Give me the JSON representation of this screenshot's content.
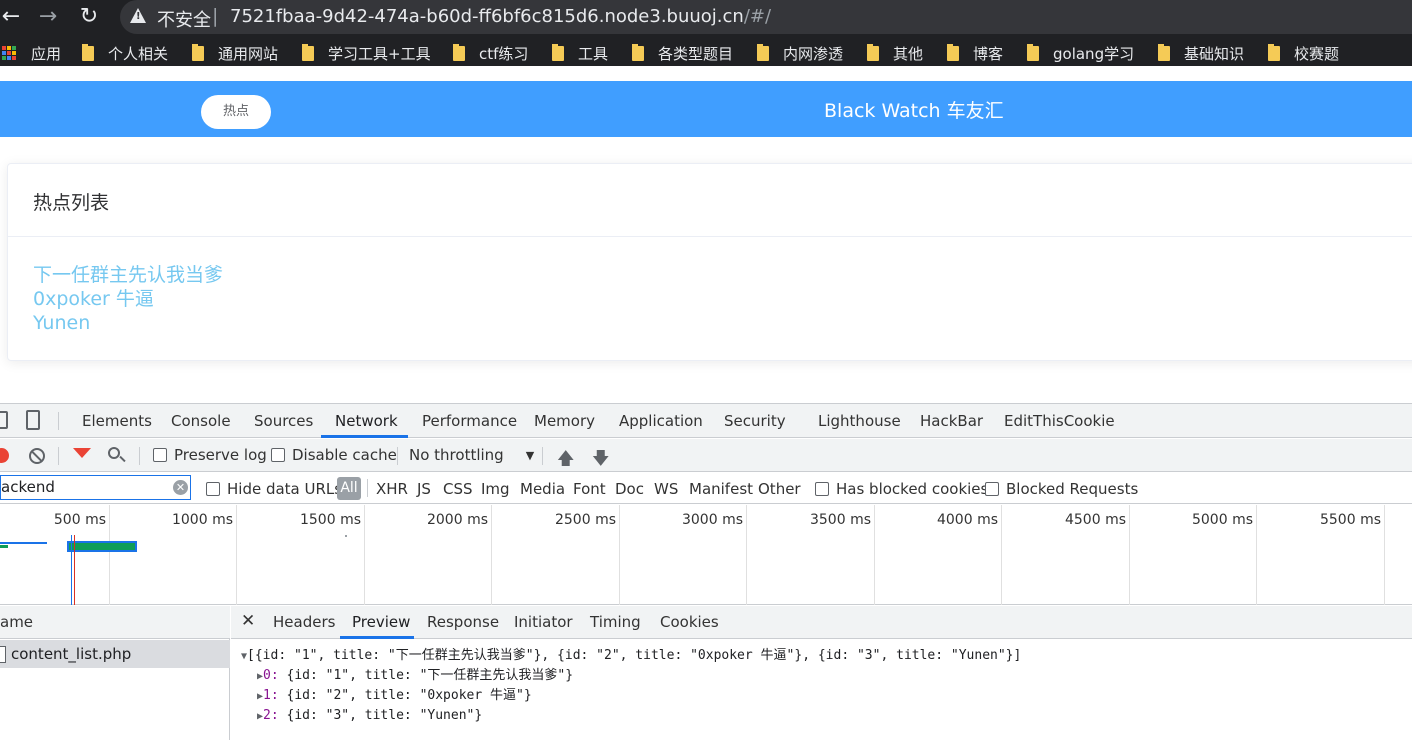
{
  "browser": {
    "not_secure_label": "不安全",
    "url_separator": "|",
    "url_host": "7521fbaa-9d42-474a-b60d-ff6bf6c815d6.node3.buuoj.cn",
    "url_path": "/#/",
    "bookmarks": [
      "应用",
      "个人相关",
      "通用网站",
      "学习工具+工具",
      "ctf练习",
      "工具",
      "各类型题目",
      "内网渗透",
      "其他",
      "博客",
      "golang学习",
      "基础知识",
      "校赛题"
    ]
  },
  "site": {
    "header_color": "#409eff",
    "hot_button": "热点",
    "title": "Black Watch 车友汇",
    "card_title": "热点列表",
    "hot_items": [
      "下一任群主先认我当爹",
      "0xpoker 牛逼",
      "Yunen"
    ],
    "link_color": "#76c8f0"
  },
  "devtools": {
    "tabs": [
      "Elements",
      "Console",
      "Sources",
      "Network",
      "Performance",
      "Memory",
      "Application",
      "Security",
      "Lighthouse",
      "HackBar",
      "EditThisCookie"
    ],
    "active_tab": "Network",
    "toolbar": {
      "preserve_log": "Preserve log",
      "disable_cache": "Disable cache",
      "throttling": "No throttling"
    },
    "filter": {
      "value": "ackend",
      "hide_data_urls": "Hide data URLs",
      "types": [
        "All",
        "XHR",
        "JS",
        "CSS",
        "Img",
        "Media",
        "Font",
        "Doc",
        "WS",
        "Manifest",
        "Other"
      ],
      "has_blocked_cookies": "Has blocked cookies",
      "blocked_requests": "Blocked Requests"
    },
    "timeline_ticks": [
      "500 ms",
      "1000 ms",
      "1500 ms",
      "2000 ms",
      "2500 ms",
      "3000 ms",
      "3500 ms",
      "4000 ms",
      "4500 ms",
      "5000 ms",
      "5500 ms"
    ],
    "name_header": "ame",
    "request_name": "content_list.php",
    "detail_tabs": [
      "Headers",
      "Preview",
      "Response",
      "Initiator",
      "Timing",
      "Cookies"
    ],
    "active_detail_tab": "Preview",
    "preview": {
      "root": "[{id: \"1\", title: \"下一任群主先认我当爹\"}, {id: \"2\", title: \"0xpoker 牛逼\"}, {id: \"3\", title: \"Yunen\"}]",
      "items": [
        {
          "index": "0:",
          "value": "{id: \"1\", title: \"下一任群主先认我当爹\"}"
        },
        {
          "index": "1:",
          "value": "{id: \"2\", title: \"0xpoker 牛逼\"}"
        },
        {
          "index": "2:",
          "value": "{id: \"3\", title: \"Yunen\"}"
        }
      ]
    }
  }
}
